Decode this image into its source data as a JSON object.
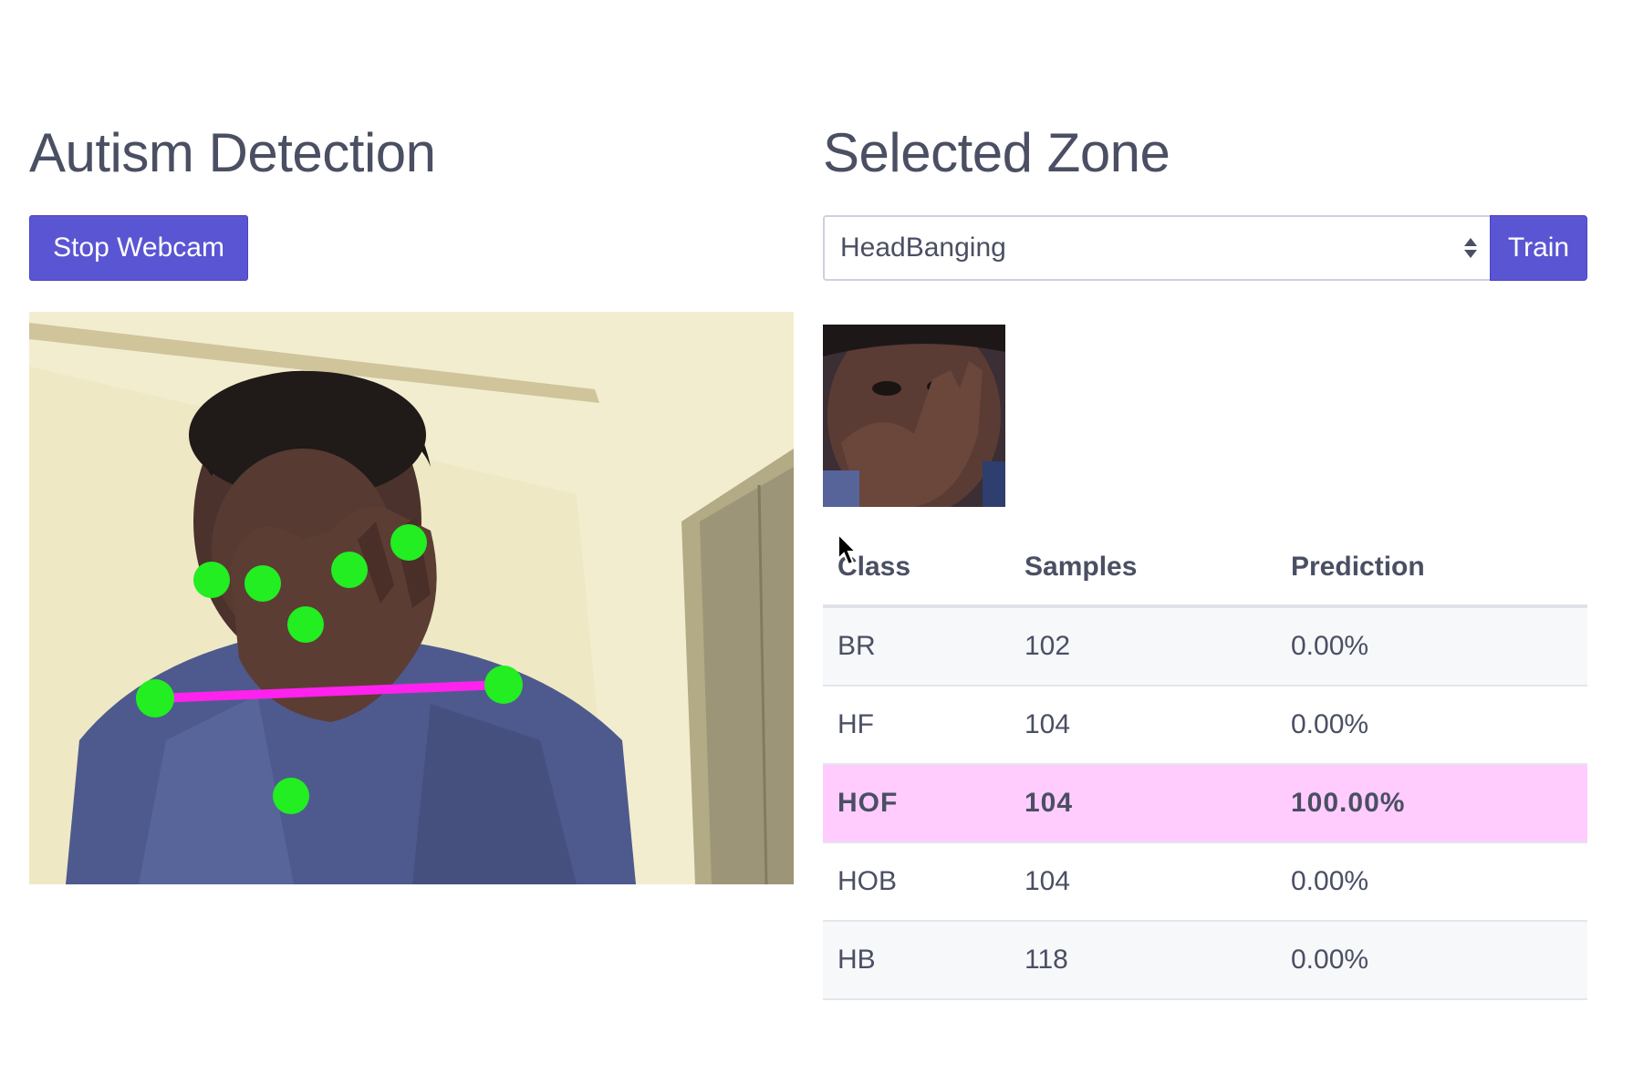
{
  "left": {
    "title": "Autism Detection",
    "stop_button": "Stop Webcam"
  },
  "right": {
    "title": "Selected Zone",
    "select_value": "HeadBanging",
    "train_button": "Train"
  },
  "table": {
    "headers": [
      "Class",
      "Samples",
      "Prediction"
    ],
    "rows": [
      {
        "class": "BR",
        "samples": "102",
        "prediction": "0.00%"
      },
      {
        "class": "HF",
        "samples": "104",
        "prediction": "0.00%"
      },
      {
        "class": "HOF",
        "samples": "104",
        "prediction": "100.00%"
      },
      {
        "class": "HOB",
        "samples": "104",
        "prediction": "0.00%"
      },
      {
        "class": "HB",
        "samples": "118",
        "prediction": "0.00%"
      }
    ]
  },
  "colors": {
    "accent": "#5a55d2",
    "highlight_row": "#ffccfd",
    "keypoint": "#22ee22",
    "skeleton_line": "#ff22ee"
  }
}
